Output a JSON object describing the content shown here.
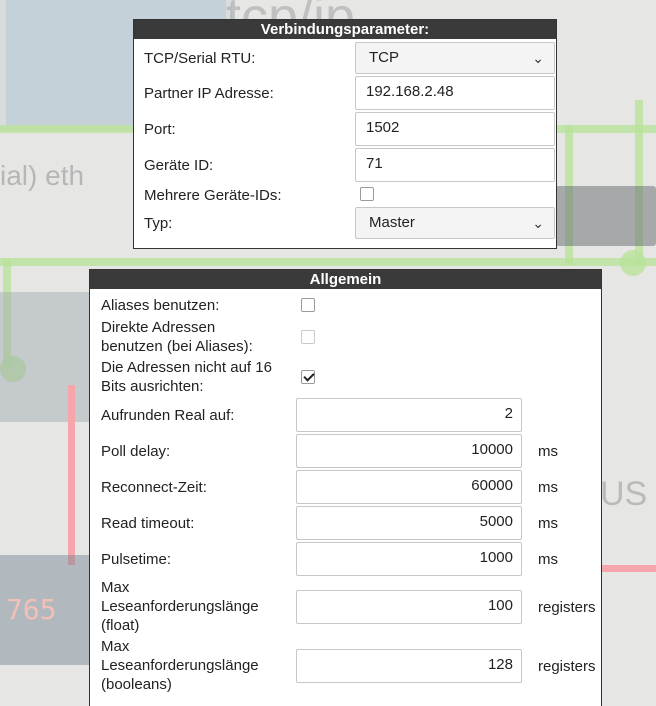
{
  "connection": {
    "title": "Verbindungsparameter:",
    "protocol": {
      "label": "TCP/Serial RTU:",
      "value": "TCP"
    },
    "partner_ip": {
      "label": "Partner IP Adresse:",
      "value": "192.168.2.48"
    },
    "port": {
      "label": "Port:",
      "value": "1502"
    },
    "device_id": {
      "label": "Geräte ID:",
      "value": "71"
    },
    "multiple_ids": {
      "label": "Mehrere Geräte-IDs:",
      "checked": false
    },
    "type": {
      "label": "Typ:",
      "value": "Master"
    }
  },
  "general": {
    "title": "Allgemein",
    "use_aliases": {
      "label": "Aliases benutzen:",
      "checked": false
    },
    "direct_addresses": {
      "label_line1": "Direkte Adressen",
      "label_line2": "benutzen (bei Aliases):",
      "checked": false,
      "disabled": true
    },
    "no_align": {
      "label_line1": "Die Adressen nicht auf 16",
      "label_line2": "Bits ausrichten:",
      "checked": true
    },
    "round_real": {
      "label": "Aufrunden Real auf:",
      "value": "2"
    },
    "poll_delay": {
      "label": "Poll delay:",
      "value": "10000",
      "unit": "ms"
    },
    "reconnect": {
      "label": "Reconnect-Zeit:",
      "value": "60000",
      "unit": "ms"
    },
    "read_timeout": {
      "label": "Read timeout:",
      "value": "5000",
      "unit": "ms"
    },
    "pulsetime": {
      "label": "Pulsetime:",
      "value": "1000",
      "unit": "ms"
    },
    "max_read_float": {
      "label_line1": "Max",
      "label_line2": "Leseanforderungslänge",
      "label_line3": "(float)",
      "value": "100",
      "unit": "registers"
    },
    "max_read_bool": {
      "label_line1": "Max",
      "label_line2": "Leseanforderungslänge",
      "label_line3": "(booleans)",
      "value": "128",
      "unit": "registers"
    }
  },
  "background": {
    "tcpip_text": "tcp/ip",
    "eth_text": "ial) eth",
    "bus_text": "US",
    "meter_text": "765"
  }
}
